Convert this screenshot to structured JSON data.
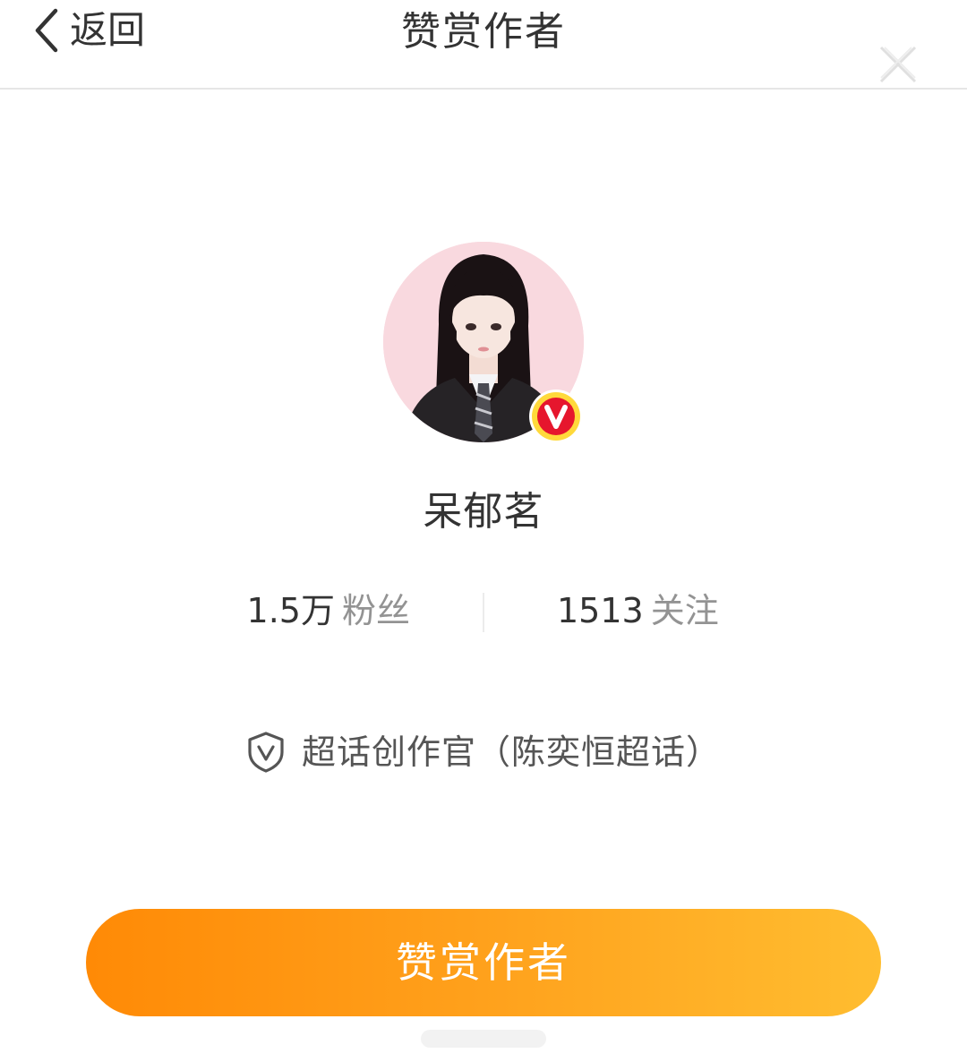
{
  "header": {
    "back_label": "返回",
    "title": "赞赏作者",
    "back_icon": "chevron-left-icon",
    "close_icon": "close-icon"
  },
  "author": {
    "name": "呆郁茗",
    "avatar_icon": "avatar",
    "verified_icon": "verified-v-icon",
    "fans_count": "1.5万",
    "fans_label": "粉丝",
    "follow_count": "1513",
    "follow_label": "关注",
    "badge_icon": "shield-v-icon",
    "badge_text": "超话创作官（陈奕恒超话）"
  },
  "action": {
    "reward_label": "赞赏作者"
  },
  "colors": {
    "accent_start": "#ff8a06",
    "accent_end": "#ffbd30",
    "verified_red": "#e6162d",
    "verified_ring": "#ffd93b",
    "label_gray": "#939393"
  }
}
